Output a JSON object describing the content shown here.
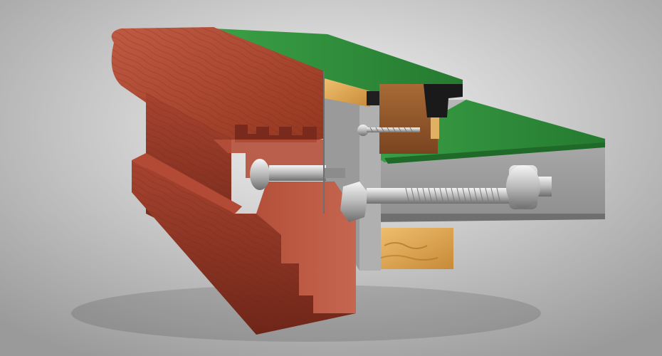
{
  "scene": {
    "subject": "rail-cutaway-render",
    "colors": {
      "background_center": "#f4f4f4",
      "background_edge": "#9a9a9a",
      "wood_light": "#b24a35",
      "wood_dark": "#7a2a1c",
      "wood_shadow": "#5e2014",
      "cloth_green": "#2f8f3a",
      "cloth_green_dark": "#1f6a28",
      "slate_grey": "#a8a8a8",
      "slate_grey_dark": "#7d7d7d",
      "rubber_black": "#1a1a1a",
      "pine_light": "#e9b25c",
      "pine_dark": "#b77a2e",
      "oak_block": "#9a5a2a",
      "steel": "#d8d8d8",
      "steel_dark": "#8c8c8c"
    }
  }
}
